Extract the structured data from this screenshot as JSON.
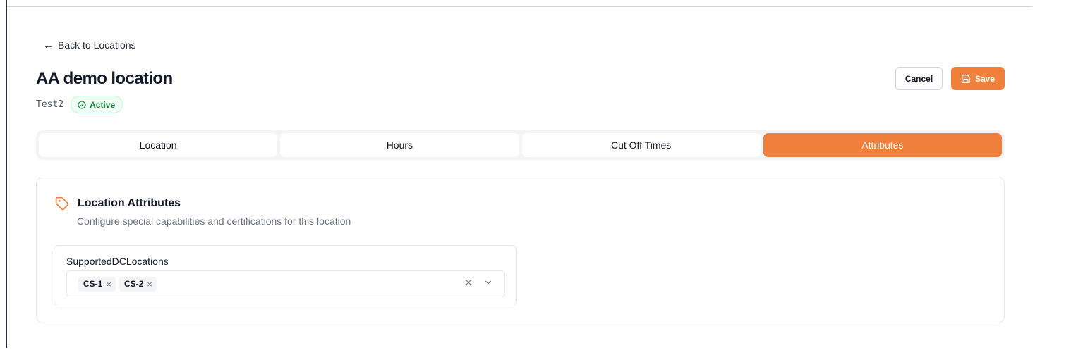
{
  "nav": {
    "back_label": "Back to Locations",
    "back_arrow": "←"
  },
  "header": {
    "title": "AA demo location",
    "code": "Test2",
    "status": "Active",
    "cancel_label": "Cancel",
    "save_label": "Save"
  },
  "tabs": [
    {
      "label": "Location",
      "active": false
    },
    {
      "label": "Hours",
      "active": false
    },
    {
      "label": "Cut Off Times",
      "active": false
    },
    {
      "label": "Attributes",
      "active": true
    }
  ],
  "attributes_card": {
    "title": "Location Attributes",
    "description": "Configure special capabilities and certifications for this location",
    "icon": "tag-icon",
    "fields": [
      {
        "label": "SupportedDCLocations",
        "selected": [
          "CS-1",
          "CS-2"
        ],
        "chip_remove": "×"
      }
    ]
  },
  "colors": {
    "accent": "#f07f3c",
    "status_green": "#15803d",
    "border": "#e5e7eb"
  }
}
